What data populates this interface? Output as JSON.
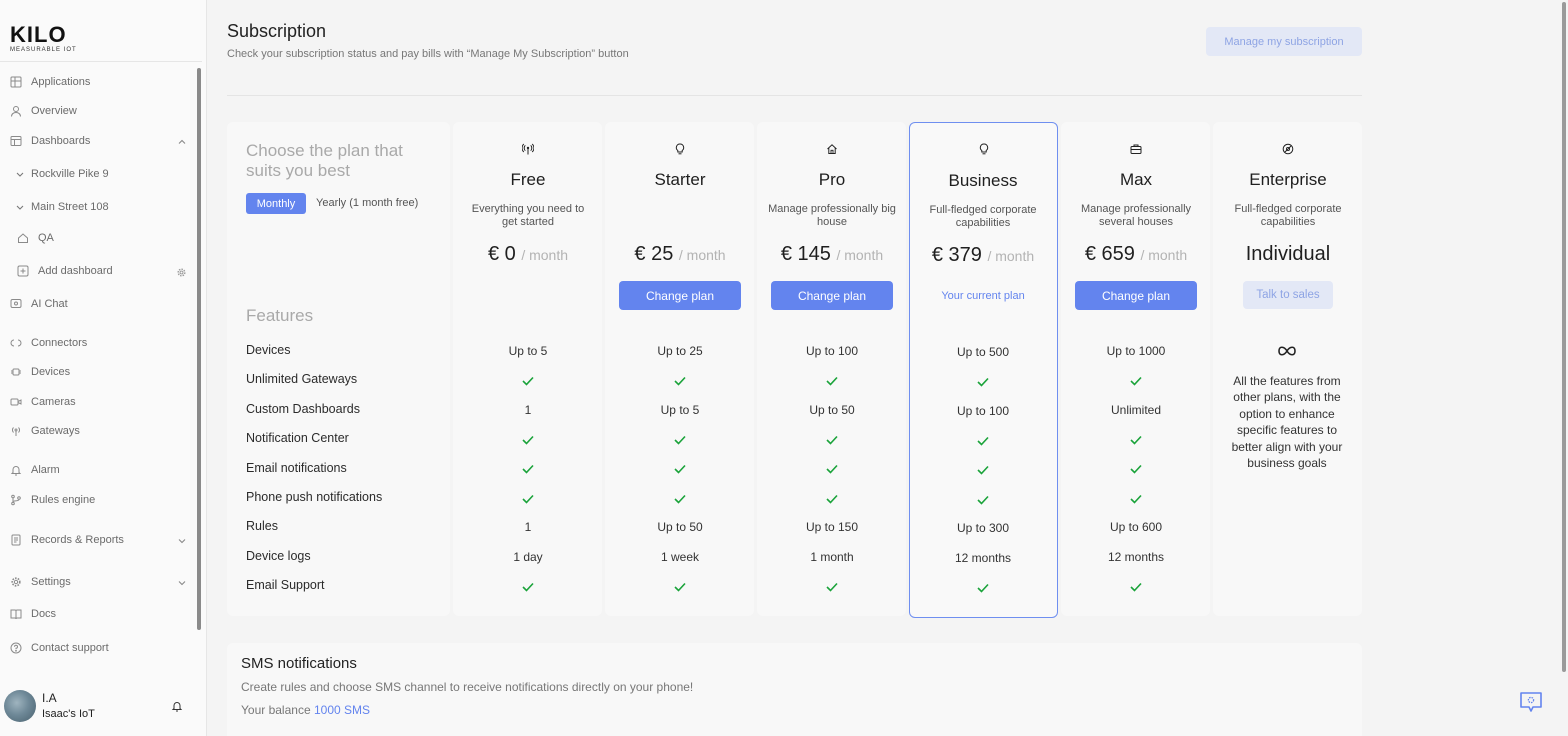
{
  "brand": {
    "logo_text": "KILO",
    "tagline": "MEASURABLE IOT"
  },
  "sidebar": {
    "items": [
      {
        "label": "Applications",
        "icon": "grid-icon"
      },
      {
        "label": "Overview",
        "icon": "user-icon"
      },
      {
        "label": "Dashboards",
        "icon": "dashboard-icon"
      },
      {
        "label": "Rockville Pike 9",
        "icon": "chevron-down-icon"
      },
      {
        "label": "Main Street 108",
        "icon": "chevron-down-icon"
      },
      {
        "label": "QA",
        "icon": "home-icon"
      },
      {
        "label": "Add dashboard",
        "icon": "plus-square-icon"
      },
      {
        "label": "AI Chat",
        "icon": "ai-chat-icon"
      },
      {
        "label": "Connectors",
        "icon": "connector-icon"
      },
      {
        "label": "Devices",
        "icon": "chip-icon"
      },
      {
        "label": "Cameras",
        "icon": "camera-icon"
      },
      {
        "label": "Gateways",
        "icon": "antenna-icon"
      },
      {
        "label": "Alarm",
        "icon": "bell-icon"
      },
      {
        "label": "Rules engine",
        "icon": "branch-icon"
      },
      {
        "label": "Records & Reports",
        "icon": "report-icon"
      },
      {
        "label": "Settings",
        "icon": "gear-icon"
      },
      {
        "label": "Docs",
        "icon": "book-icon"
      },
      {
        "label": "Contact support",
        "icon": "help-icon"
      }
    ],
    "user": {
      "name": "I.A",
      "org": "Isaac's IoT"
    }
  },
  "header": {
    "title": "Subscription",
    "subtitle": "Check your subscription status and pay bills with “Manage My Subscription” button",
    "manage_label": "Manage my subscription"
  },
  "plans_intro": {
    "title": "Choose the plan that suits you best",
    "monthly_label": "Monthly",
    "yearly_label": "Yearly (1 month free)",
    "features_title": "Features"
  },
  "features": [
    "Devices",
    "Unlimited Gateways",
    "Custom Dashboards",
    "Notification Center",
    "Email notifications",
    "Phone push notifications",
    "Rules",
    "Device logs",
    "Email Support"
  ],
  "plans": [
    {
      "name": "Free",
      "icon": "antenna-icon",
      "desc": "Everything you need to get started",
      "currency": "€",
      "price": "0",
      "per": "/ month",
      "action": "",
      "values": [
        "Up to 5",
        "✓",
        "1",
        "✓",
        "✓",
        "✓",
        "1",
        "1 day",
        "✓"
      ]
    },
    {
      "name": "Starter",
      "icon": "bulb-icon",
      "desc": "",
      "currency": "€",
      "price": "25",
      "per": "/ month",
      "action": "Change plan",
      "values": [
        "Up to 25",
        "✓",
        "Up to 5",
        "✓",
        "✓",
        "✓",
        "Up to 50",
        "1 week",
        "✓"
      ]
    },
    {
      "name": "Pro",
      "icon": "home-icon",
      "desc": "Manage professionally big house",
      "currency": "€",
      "price": "145",
      "per": "/ month",
      "action": "Change plan",
      "values": [
        "Up to 100",
        "✓",
        "Up to 50",
        "✓",
        "✓",
        "✓",
        "Up to 150",
        "1 month",
        "✓"
      ]
    },
    {
      "name": "Business",
      "icon": "bulb-icon",
      "desc": "Full-fledged corporate capabilities",
      "currency": "€",
      "price": "379",
      "per": "/ month",
      "action": "Your current plan",
      "values": [
        "Up to 500",
        "✓",
        "Up to 100",
        "✓",
        "✓",
        "✓",
        "Up to 300",
        "12 months",
        "✓"
      ]
    },
    {
      "name": "Max",
      "icon": "briefcase-icon",
      "desc": "Manage professionally several houses",
      "currency": "€",
      "price": "659",
      "per": "/ month",
      "action": "Change plan",
      "values": [
        "Up to 1000",
        "✓",
        "Unlimited",
        "✓",
        "✓",
        "✓",
        "Up to 600",
        "12 months",
        "✓"
      ]
    },
    {
      "name": "Enterprise",
      "icon": "enterprise-icon",
      "desc": "Full-fledged corporate capabilities",
      "price_text": "Individual",
      "action": "Talk to sales",
      "features_symbol": "∞",
      "features_text": "All the features from other plans, with the option to enhance specific features to better align with your business goals"
    }
  ],
  "sms": {
    "title": "SMS notifications",
    "desc": "Create rules and choose SMS channel to receive notifications directly on your phone!",
    "balance_label": "Your balance",
    "balance_value": "1000 SMS"
  },
  "colors": {
    "accent": "#6384ee",
    "check": "#1aa33a",
    "muted_button_bg": "#e3e8f6"
  }
}
